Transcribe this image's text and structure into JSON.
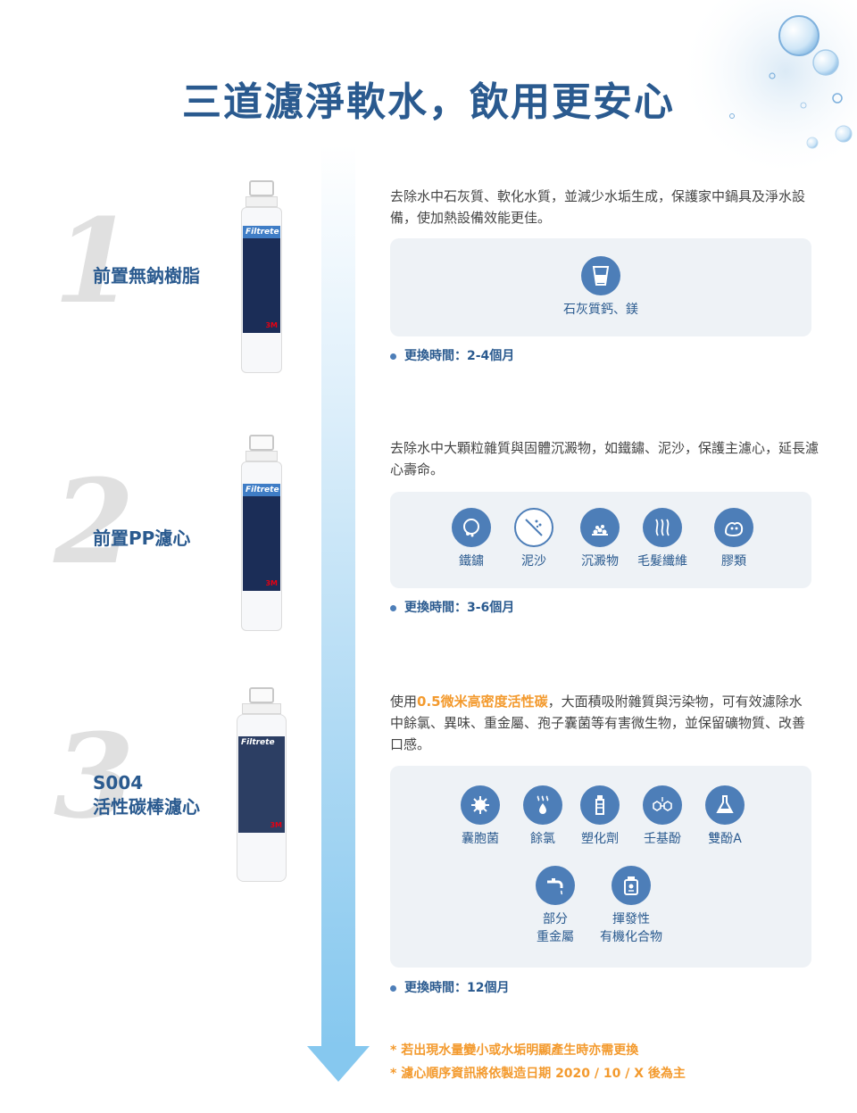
{
  "title": "三道濾淨軟水，飲用更安心",
  "stages": [
    {
      "number": "1",
      "name_line1": "前置無鈉樹脂",
      "filter_brand": "Filtrete",
      "filter_logo": "3M",
      "description": "去除水中石灰質、軟化水質，並減少水垢生成，保護家中鍋具及淨水設備，使加熱設備效能更佳。",
      "icons": [
        {
          "label": "石灰質鈣、鎂",
          "icon": "water-glass-icon"
        }
      ],
      "replace": "更換時間：2-4個月"
    },
    {
      "number": "2",
      "name_line1": "前置PP濾心",
      "filter_brand": "Filtrete",
      "filter_logo": "3M",
      "description": "去除水中大顆粒雜質與固體沉澱物，如鐵鏽、泥沙，保護主濾心，延長濾心壽命。",
      "icons": [
        {
          "label": "鐵鏽",
          "icon": "rusty-pipe-icon"
        },
        {
          "label": "泥沙",
          "icon": "sand-icon"
        },
        {
          "label": "沉澱物",
          "icon": "sediment-icon"
        },
        {
          "label": "毛髮纖維",
          "icon": "hair-fiber-icon"
        },
        {
          "label": "膠類",
          "icon": "colloid-icon"
        }
      ],
      "replace": "更換時間：3-6個月"
    },
    {
      "number": "3",
      "name_line1": "S004",
      "name_line2": "活性碳棒濾心",
      "filter_brand": "Filtrete",
      "filter_logo": "3M",
      "description_prefix": "使用",
      "description_highlight": "0.5微米高密度活性碳",
      "description_suffix": "，大面積吸附雜質與污染物，可有效濾除水中餘氯、異味、重金屬、孢子囊菌等有害微生物，並保留礦物質、改善口感。",
      "icons": [
        {
          "label": "囊胞菌",
          "icon": "bacteria-icon"
        },
        {
          "label": "餘氯",
          "icon": "chlorine-icon"
        },
        {
          "label": "塑化劑",
          "icon": "plastic-bottle-icon"
        },
        {
          "label": "壬基酚",
          "icon": "molecule-icon"
        },
        {
          "label": "雙酚A",
          "icon": "flask-icon"
        },
        {
          "label_line1": "部分",
          "label_line2": "重金屬",
          "icon": "faucet-icon"
        },
        {
          "label_line1": "揮發性",
          "label_line2": "有機化合物",
          "icon": "chemical-jar-icon"
        }
      ],
      "replace": "更換時間：12個月"
    }
  ],
  "notes": [
    "* 若出現水量變小或水垢明顯產生時亦需更換",
    "* 濾心順序資訊將依製造日期 2020 / 10 / X 後為主"
  ],
  "colors": {
    "primary": "#2a5a8f",
    "accent": "#f39a2e",
    "icon_bg": "#4d7eb8",
    "panel_bg": "#eef2f6",
    "arrow": "#86c8ef"
  }
}
